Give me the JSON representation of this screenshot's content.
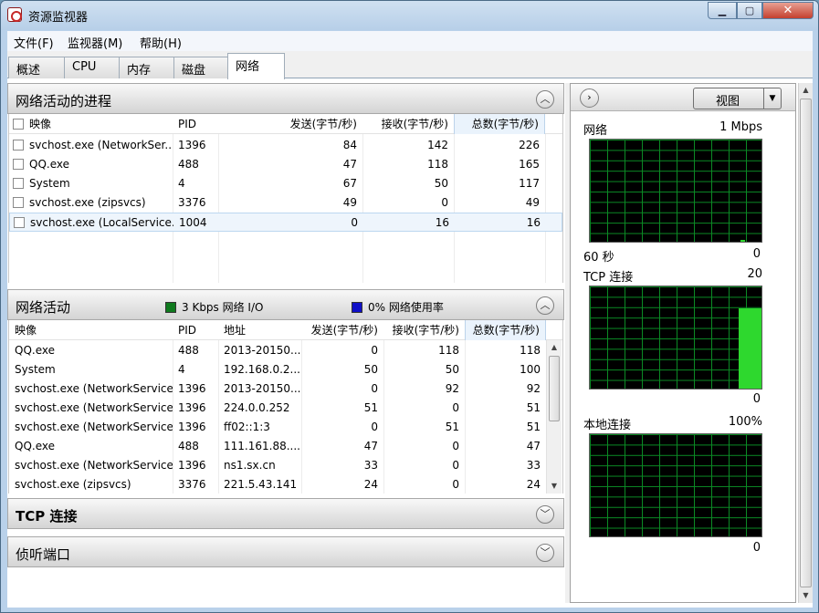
{
  "window": {
    "title": "资源监视器"
  },
  "controls": {
    "minimize": "▁",
    "maximize": "▢",
    "close": "✕"
  },
  "menu": [
    "文件(F)",
    "监视器(M)",
    "帮助(H)"
  ],
  "tabs": [
    {
      "label": "概述",
      "active": false
    },
    {
      "label": "CPU",
      "active": false
    },
    {
      "label": "内存",
      "active": false
    },
    {
      "label": "磁盘",
      "active": false
    },
    {
      "label": "网络",
      "active": true
    }
  ],
  "processes": {
    "title": "网络活动的进程",
    "columns": [
      "映像",
      "PID",
      "发送(字节/秒)",
      "接收(字节/秒)",
      "总数(字节/秒)"
    ],
    "rows": [
      {
        "image": "svchost.exe (NetworkSer...",
        "pid": "1396",
        "send": "84",
        "recv": "142",
        "total": "226"
      },
      {
        "image": "QQ.exe",
        "pid": "488",
        "send": "47",
        "recv": "118",
        "total": "165"
      },
      {
        "image": "System",
        "pid": "4",
        "send": "67",
        "recv": "50",
        "total": "117"
      },
      {
        "image": "svchost.exe (zipsvcs)",
        "pid": "3376",
        "send": "49",
        "recv": "0",
        "total": "49"
      },
      {
        "image": "svchost.exe (LocalService...",
        "pid": "1004",
        "send": "0",
        "recv": "16",
        "total": "16"
      }
    ]
  },
  "activity": {
    "title": "网络活动",
    "io_legend": "3 Kbps 网络 I/O",
    "usage_legend": "0% 网络使用率",
    "io_color": "#0f7a1e",
    "usage_color": "#1010c8",
    "columns": [
      "映像",
      "PID",
      "地址",
      "发送(字节/秒)",
      "接收(字节/秒)",
      "总数(字节/秒)"
    ],
    "rows": [
      {
        "image": "QQ.exe",
        "pid": "488",
        "addr": "2013-20150...",
        "send": "0",
        "recv": "118",
        "total": "118"
      },
      {
        "image": "System",
        "pid": "4",
        "addr": "192.168.0.2...",
        "send": "50",
        "recv": "50",
        "total": "100"
      },
      {
        "image": "svchost.exe (NetworkService)",
        "pid": "1396",
        "addr": "2013-20150...",
        "send": "0",
        "recv": "92",
        "total": "92"
      },
      {
        "image": "svchost.exe (NetworkService)",
        "pid": "1396",
        "addr": "224.0.0.252",
        "send": "51",
        "recv": "0",
        "total": "51"
      },
      {
        "image": "svchost.exe (NetworkService)",
        "pid": "1396",
        "addr": "ff02::1:3",
        "send": "0",
        "recv": "51",
        "total": "51"
      },
      {
        "image": "QQ.exe",
        "pid": "488",
        "addr": "111.161.88....",
        "send": "47",
        "recv": "0",
        "total": "47"
      },
      {
        "image": "svchost.exe (NetworkService)",
        "pid": "1396",
        "addr": "ns1.sx.cn",
        "send": "33",
        "recv": "0",
        "total": "33"
      },
      {
        "image": "svchost.exe (zipsvcs)",
        "pid": "3376",
        "addr": "221.5.43.141",
        "send": "24",
        "recv": "0",
        "total": "24"
      }
    ]
  },
  "tcp": {
    "title": "TCP 连接"
  },
  "listen": {
    "title": "侦听端口"
  },
  "side": {
    "view_label": "视图",
    "graphs": [
      {
        "title": "网络",
        "max": "1 Mbps",
        "time_label": "60 秒",
        "min": "0"
      },
      {
        "title": "TCP 连接",
        "max": "20",
        "min": "0"
      },
      {
        "title": "本地连接",
        "max": "100%",
        "min": "0"
      }
    ]
  }
}
